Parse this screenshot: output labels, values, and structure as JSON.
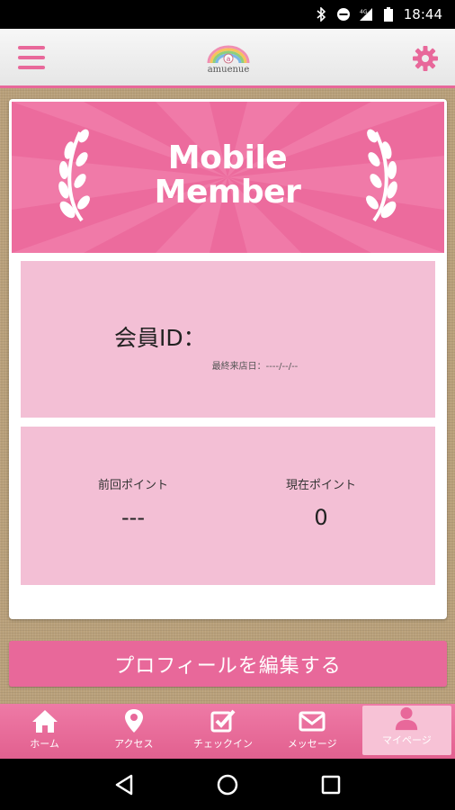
{
  "status_bar": {
    "time": "18:44",
    "icons": [
      "bluetooth-icon",
      "do-not-disturb-icon",
      "signal-4g-icon",
      "battery-icon"
    ]
  },
  "app_bar": {
    "logo_text": "amuenue",
    "accent_color": "#e8689a"
  },
  "member_card": {
    "banner_title": "Mobile Member",
    "banner_color": "#ec6b9d",
    "member_id_label": "会員ID：",
    "last_visit_label": "最終来店日：----/--/--",
    "previous_points": {
      "label": "前回ポイント",
      "value": "---"
    },
    "current_points": {
      "label": "現在ポイント",
      "value": "0"
    }
  },
  "edit_profile_label": "プロフィールを編集する",
  "tabs": [
    {
      "label": "ホーム",
      "icon": "home-icon",
      "active": false
    },
    {
      "label": "アクセス",
      "icon": "map-pin-icon",
      "active": false
    },
    {
      "label": "チェックイン",
      "icon": "checkbox-icon",
      "active": false
    },
    {
      "label": "メッセージ",
      "icon": "envelope-icon",
      "active": false
    },
    {
      "label": "マイページ",
      "icon": "person-icon",
      "active": true
    }
  ],
  "system_nav": [
    "back-icon",
    "home-circle-icon",
    "recents-icon"
  ]
}
